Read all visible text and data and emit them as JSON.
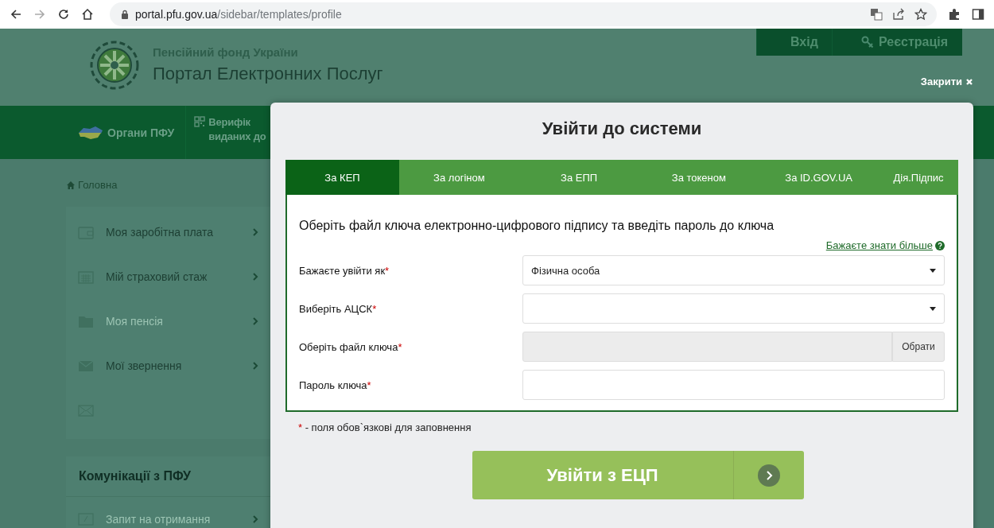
{
  "browser": {
    "host": "portal.pfu.gov.ua",
    "path": "/sidebar/templates/profile"
  },
  "header": {
    "org": "Пенсійний фонд України",
    "title": "Портал Електронних Послуг",
    "auth": [
      {
        "label": "Вхід",
        "kind": "login"
      },
      {
        "label": "Реєстрація",
        "kind": "register"
      }
    ],
    "close": "Закрити"
  },
  "nav": [
    {
      "lines": [
        "Органи ПФУ"
      ],
      "kind": "map"
    },
    {
      "lines": [
        "Верифік",
        "виданих до"
      ],
      "kind": "qr"
    }
  ],
  "breadcrumb": "Головна",
  "sidebar": {
    "items": [
      {
        "label": "Моя заробітна плата",
        "kind": "wallet",
        "disabled": false
      },
      {
        "label": "Мій страховий стаж",
        "kind": "calendar",
        "disabled": false
      },
      {
        "label": "Моя пенсія",
        "kind": "folder",
        "disabled": true
      },
      {
        "label": "Мої звернення",
        "kind": "mail",
        "disabled": false
      },
      {
        "kind": "mail-outline"
      }
    ],
    "section": "Комунікації з ПФУ",
    "section_items": [
      {
        "label": "Запит на отримання",
        "kind": "request",
        "disabled": true
      }
    ]
  },
  "modal": {
    "title": "Увійти до системи",
    "tabs": [
      {
        "label": "За КЕП",
        "selected": true
      },
      {
        "label": "За логіном",
        "selected": false
      },
      {
        "label": "За ЕПП",
        "selected": false
      },
      {
        "label": "За токеном",
        "selected": false
      },
      {
        "label": "За ID.GOV.UA",
        "selected": false
      },
      {
        "label": "Дія.Підпис",
        "selected": false
      }
    ],
    "instruction": "Оберіть файл ключа електронно-цифрового підпису та введіть пароль до ключа",
    "help_link": "Бажаєте знати більше",
    "fields": [
      {
        "label": "Бажаєте увійти як",
        "mark": "*",
        "kind": "select",
        "value": "Фізична особа"
      },
      {
        "label": "Виберіть АЦСК",
        "mark": "*",
        "kind": "select"
      },
      {
        "label": "Оберіть файл ключа",
        "mark": "*",
        "kind": "file",
        "button": "Обрати"
      },
      {
        "label": "Пароль ключа",
        "mark": "*",
        "kind": "password"
      }
    ],
    "note_mark": "*",
    "note": "- поля обов`язкові для заповнення",
    "submit": "Увійти з ЕЦП"
  }
}
